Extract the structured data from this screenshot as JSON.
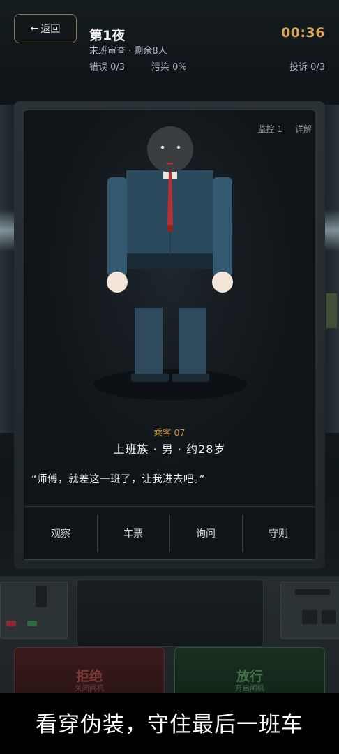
{
  "header": {
    "back_label": "返回",
    "night_title": "第1夜",
    "subtitle": "末班审查 · 剩余8人",
    "timer": "00:36",
    "errors": "错误 0/3",
    "pollution": "污染 0%",
    "complaints": "投诉 0/3"
  },
  "monitor": {
    "camera_label": "监控 1",
    "detail_label": "详解"
  },
  "passenger": {
    "tag": "乘客 07",
    "description": "上班族 · 男 · 约28岁",
    "quote": "“师傅，就差这一班了，让我进去吧。”"
  },
  "actions": [
    "观察",
    "车票",
    "询问",
    "守则"
  ],
  "controls": {
    "reject_label": "拒绝",
    "reject_sub": "关闭闸机",
    "pass_label": "放行",
    "pass_sub": "开启闸机"
  },
  "caption": "看穿伪装，守住最后一班车",
  "colors": {
    "accent_gold": "#d9a556",
    "passenger_tag": "#c9963d",
    "reject": "#7e3a39",
    "pass": "#3f7149"
  },
  "icons": {
    "back": "arrow-left-icon"
  }
}
